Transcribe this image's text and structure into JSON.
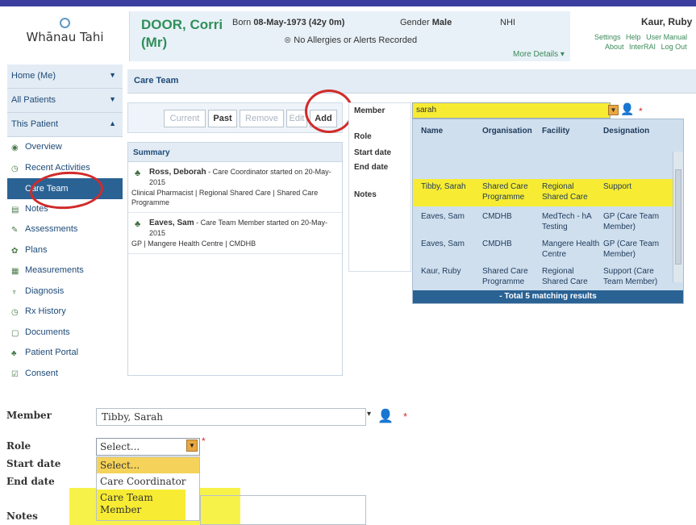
{
  "header": {
    "logo_text": "Whānau Tahi",
    "patient_name": "DOOR, Corri",
    "patient_title": "(Mr)",
    "born_label": "Born",
    "born_value": "08-May-1973 (42y 0m)",
    "gender_label": "Gender",
    "gender_value": "Male",
    "nhi_label": "NHI",
    "alerts": "No Allergies or Alerts Recorded",
    "more_details": "More Details ▾",
    "user_name": "Kaur, Ruby",
    "links": [
      "Settings",
      "Help",
      "User Manual",
      "About",
      "InterRAI",
      "Log Out"
    ]
  },
  "sidebar": {
    "top_items": [
      {
        "label": "Home (Me)",
        "arrow": "▼"
      },
      {
        "label": "All Patients",
        "arrow": "▼"
      },
      {
        "label": "This Patient",
        "arrow": "▲"
      }
    ],
    "items": [
      {
        "label": "Overview",
        "icon": "eye-icon"
      },
      {
        "label": "Recent Activities",
        "icon": "clock-icon"
      },
      {
        "label": "Care Team",
        "icon": "people-icon"
      },
      {
        "label": "Notes",
        "icon": "notes-icon"
      },
      {
        "label": "Assessments",
        "icon": "assessment-icon"
      },
      {
        "label": "Plans",
        "icon": "plans-icon"
      },
      {
        "label": "Measurements",
        "icon": "measurement-icon"
      },
      {
        "label": "Diagnosis",
        "icon": "diagnosis-icon"
      },
      {
        "label": "Rx History",
        "icon": "rx-icon"
      },
      {
        "label": "Documents",
        "icon": "document-icon"
      },
      {
        "label": "Patient Portal",
        "icon": "portal-icon"
      },
      {
        "label": "Consent",
        "icon": "consent-icon"
      }
    ]
  },
  "main": {
    "title": "Care Team",
    "buttons": [
      "Current",
      "Past",
      "Remove",
      "Edit",
      "Add"
    ],
    "summary_title": "Summary",
    "summary_items": [
      {
        "name": "Ross, Deborah",
        "text": " - Care Coordinator started on 20-May-2015",
        "sub": "Clinical Pharmacist | Regional Shared Care | Shared Care Programme"
      },
      {
        "name": "Eaves, Sam",
        "text": " - Care Team Member started on 20-May-2015",
        "sub": "GP | Mangere Health Centre | CMDHB"
      }
    ]
  },
  "form": {
    "member_label": "Member",
    "role_label": "Role",
    "start_label": "Start date",
    "end_label": "End date",
    "notes_label": "Notes",
    "member_value": "sarah",
    "required_mark": "*"
  },
  "results": {
    "headers": [
      "Name",
      "Organisation",
      "Facility",
      "Designation"
    ],
    "rows": [
      {
        "name": "Tibby, Sarah",
        "org": "Shared Care Programme",
        "facility": "Regional Shared Care",
        "designation": "Support"
      },
      {
        "name": "Eaves, Sam",
        "org": "CMDHB",
        "facility": "MedTech - hA Testing",
        "designation": "GP (Care Team Member)"
      },
      {
        "name": "Eaves, Sam",
        "org": "CMDHB",
        "facility": "Mangere Health Centre",
        "designation": "GP (Care Team Member)"
      },
      {
        "name": "Kaur, Ruby",
        "org": "Shared Care Programme",
        "facility": "Regional Shared Care",
        "designation": "Support (Care Team Member)"
      }
    ],
    "total": "- Total 5 matching results"
  },
  "bottom": {
    "member_label": "Member",
    "member_value": "Tibby, Sarah",
    "role_label": "Role",
    "role_value": "Select...",
    "start_label": "Start date",
    "end_label": "End date",
    "notes_label": "Notes",
    "options": [
      "Select...",
      "Care Coordinator",
      "Care Team Member"
    ]
  }
}
